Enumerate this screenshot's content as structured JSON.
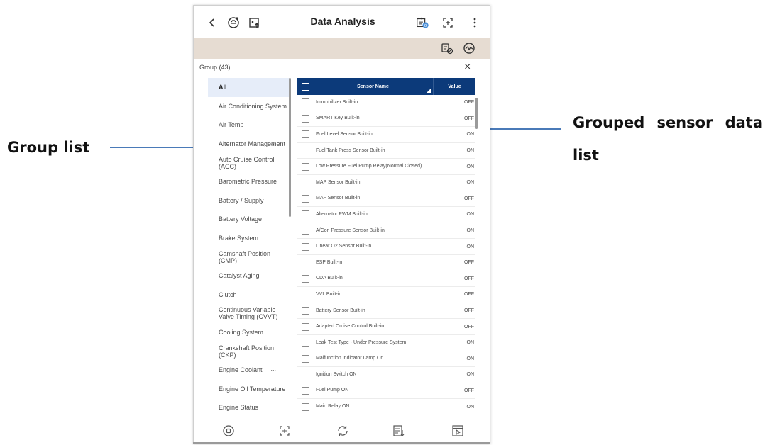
{
  "annotations": {
    "group_list_label": "Group list",
    "sensor_list_label": "Grouped sensor data list"
  },
  "app": {
    "title": "Data Analysis",
    "group_header": "Group (43)",
    "close_glyph": "×"
  },
  "icons": {
    "top": [
      "back-icon",
      "vehicle-scan-icon",
      "upload-icon",
      "freeze-frame-icon",
      "crosshair-icon",
      "more-vert-icon"
    ],
    "toolbar": [
      "car-settings-icon",
      "gauge-icon"
    ],
    "bottom": [
      "record-icon",
      "capture-icon",
      "refresh-icon",
      "report-icon",
      "playback-icon"
    ],
    "accent": "#0c3a7a",
    "toolbar_color": "#e6dcd2"
  },
  "groups": [
    {
      "label": "All",
      "active": true
    },
    {
      "label": "Air Conditioning System"
    },
    {
      "label": "Air Temp"
    },
    {
      "label": "Alternator Management",
      "dots": "..."
    },
    {
      "label": "Auto Cruise Control (ACC)"
    },
    {
      "label": "Barometric Pressure"
    },
    {
      "label": "Battery / Supply"
    },
    {
      "label": "Battery Voltage"
    },
    {
      "label": "Brake System"
    },
    {
      "label": "Camshaft Position (CMP)"
    },
    {
      "label": "Catalyst Aging"
    },
    {
      "label": "Clutch"
    },
    {
      "label": "Continuous Variable Valve Timing (CVVT)"
    },
    {
      "label": "Cooling System"
    },
    {
      "label": "Crankshaft Position (CKP)"
    },
    {
      "label": "Engine Coolant",
      "dots": "..."
    },
    {
      "label": "Engine Oil Temperature",
      "dots": "..."
    },
    {
      "label": "Engine Status"
    }
  ],
  "table": {
    "col_name": "Sensor Name",
    "col_value": "Value",
    "rows": [
      {
        "name": "Immobilizer Built-in",
        "value": "OFF"
      },
      {
        "name": "SMART Key Built-in",
        "value": "OFF"
      },
      {
        "name": "Fuel Level Sensor Built-in",
        "value": "ON"
      },
      {
        "name": "Fuel Tank Press Sensor Built-in",
        "value": "ON"
      },
      {
        "name": "Low Pressure Fuel Pump Relay(Normal Closed)",
        "value": "ON"
      },
      {
        "name": "MAP Sensor Built-in",
        "value": "ON"
      },
      {
        "name": "MAF Sensor Built-in",
        "value": "OFF"
      },
      {
        "name": "Alternator PWM Built-in",
        "value": "ON"
      },
      {
        "name": "A/Con Pressure Sensor Built-in",
        "value": "ON"
      },
      {
        "name": "Linear O2 Sensor Built-in",
        "value": "ON"
      },
      {
        "name": "ESP Built-in",
        "value": "OFF"
      },
      {
        "name": "CDA Built-in",
        "value": "OFF"
      },
      {
        "name": "VVL Built-in",
        "value": "OFF"
      },
      {
        "name": "Battery Sensor Built-in",
        "value": "OFF"
      },
      {
        "name": "Adapted Cruise Control Built-in",
        "value": "OFF"
      },
      {
        "name": "Leak Test Type - Under Pressure System",
        "value": "ON"
      },
      {
        "name": "Malfunction Indicator Lamp On",
        "value": "ON"
      },
      {
        "name": "Ignition Switch ON",
        "value": "ON"
      },
      {
        "name": "Fuel Pump ON",
        "value": "OFF"
      },
      {
        "name": "Main Relay ON",
        "value": "ON"
      }
    ]
  }
}
